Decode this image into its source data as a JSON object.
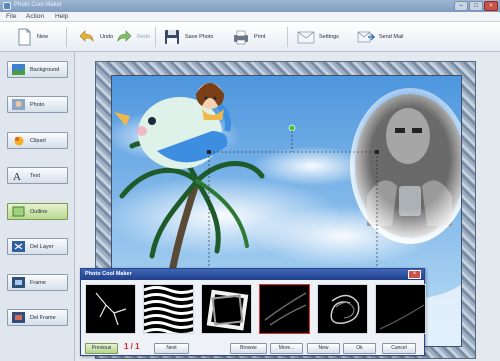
{
  "window": {
    "title": "Photo Cool Maker"
  },
  "menu": [
    "File",
    "Action",
    "Help"
  ],
  "toolbar": {
    "new": "New",
    "undo": "Undo",
    "redo": "Redo",
    "save_photo": "Save Photo",
    "print": "Print",
    "settings": "Settings",
    "send_mail": "Send Mail"
  },
  "sidebar": [
    {
      "label": "Background",
      "icon": "background-icon"
    },
    {
      "label": "Photo",
      "icon": "photo-icon"
    },
    {
      "label": "Clipart",
      "icon": "clipart-icon"
    },
    {
      "label": "Text",
      "icon": "text-icon"
    },
    {
      "label": "Outline",
      "icon": "outline-icon",
      "active": true
    },
    {
      "label": "Del Layer",
      "icon": "delete-layer-icon"
    },
    {
      "label": "Frame",
      "icon": "frame-icon"
    },
    {
      "label": "Del Frame",
      "icon": "delete-frame-icon"
    }
  ],
  "dialog": {
    "title": "Photo Cool Maker",
    "pager": "1 / 1",
    "buttons": {
      "previous": "Previous",
      "next": "Next",
      "browse": "Browse",
      "more": "More...",
      "new": "New",
      "ok": "Ok",
      "cancel": "Cancel"
    },
    "selected_thumb": 4
  },
  "colors": {
    "accent": "#1f3f8a",
    "sky": "#5aa4e6",
    "active_green": "#b9d98f",
    "selection_red": "#e03131"
  }
}
